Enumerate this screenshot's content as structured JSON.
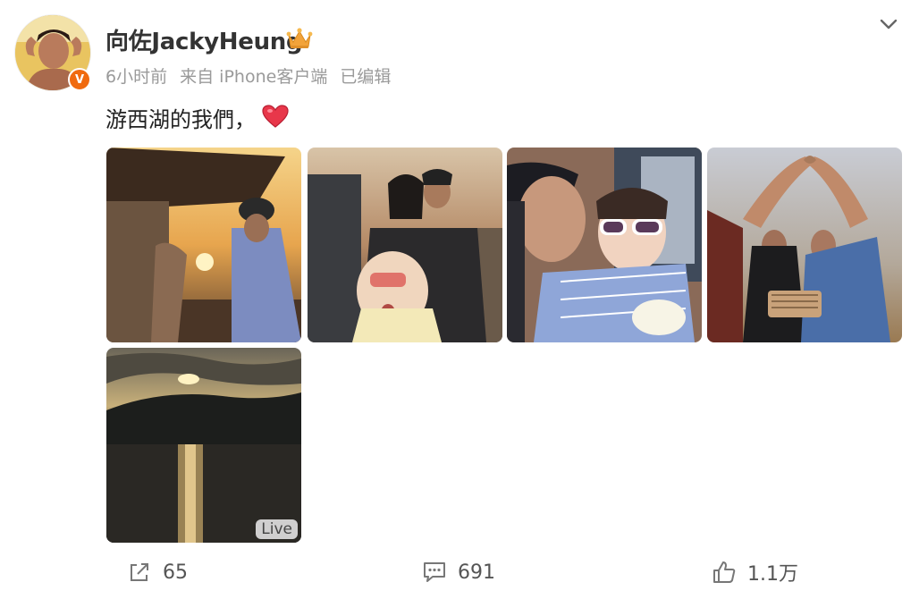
{
  "post": {
    "author": {
      "name": "向佐JackyHeung",
      "verified_mark": "V"
    },
    "meta": {
      "time": "6小时前",
      "source": "来自 iPhone客户端",
      "edited": "已编辑"
    },
    "text": "游西湖的我們，",
    "photos": [
      {
        "label": "sunset-heart-photo"
      },
      {
        "label": "family-selfie-photo"
      },
      {
        "label": "girl-sunglasses-photo"
      },
      {
        "label": "couple-heart-photo"
      },
      {
        "label": "lake-sunset-photo",
        "badge": "Live"
      }
    ],
    "actions": {
      "share_count": "65",
      "comment_count": "691",
      "like_count": "1.1万"
    }
  },
  "icons": [
    "crown-icon",
    "chevron-down-icon",
    "heart-icon",
    "share-icon",
    "comment-icon",
    "like-icon"
  ],
  "colors": {
    "verified": "#f06a0f",
    "heart": "#e8374a",
    "crown": "#f2a33a"
  }
}
